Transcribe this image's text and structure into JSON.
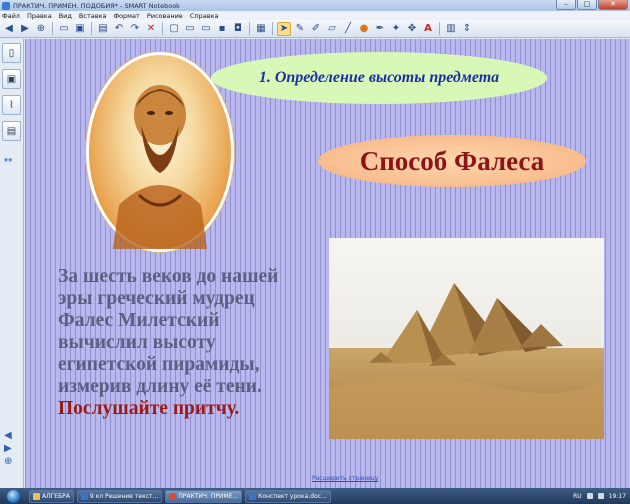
{
  "window": {
    "title": "ПРАКТИЧ. ПРИМЕН. ПОДОБИЯ* - SMART Notebook",
    "minimize": "–",
    "maximize": "□",
    "close": "✕"
  },
  "menu": [
    "Файл",
    "Правка",
    "Вид",
    "Вставка",
    "Формат",
    "Рисование",
    "Справка"
  ],
  "toolbar": {
    "icons": [
      "back-icon",
      "forward-icon",
      "add-page-icon",
      "open-icon",
      "save-icon",
      "paste-icon",
      "undo-icon",
      "redo-icon",
      "delete-icon",
      "screen-shade-icon",
      "full-screen-icon",
      "display-icon",
      "record-icon",
      "document-camera-icon",
      "table-icon",
      "select-icon",
      "pen-icon",
      "creative-pen-icon",
      "eraser-icon",
      "line-icon",
      "shape-icon",
      "fill-icon",
      "magic-pen-icon",
      "text-icon",
      "properties-icon",
      "toolbar-options-icon"
    ]
  },
  "slide": {
    "heading": "1. Определение высоты предмета",
    "method_title": "Способ Фалеса",
    "body_lines": [
      "За шесть веков до нашей",
      "эры греческий мудрец",
      "Фалес Милетский",
      "вычислил высоту",
      "египетской пирамиды,",
      "измерив длину её тени."
    ],
    "accent_line": "Послушайте притчу.",
    "page_link": "Расширить страницу"
  },
  "colors": {
    "canvas_bg": "#b8b7ee",
    "heading_oval": "#d8f8b8",
    "heading_text": "#1c2fa6",
    "method_oval": "#f9c193",
    "method_text": "#8a1418",
    "body_text": "#5b5f80",
    "accent_text": "#9b1a16"
  },
  "taskbar": {
    "items": [
      {
        "label": "АЛГЕБРА",
        "active": false
      },
      {
        "label": "9 кл Решение текст...",
        "active": false
      },
      {
        "label": "ПРАКТИЧ. ПРИМЕ...",
        "active": true
      },
      {
        "label": "Конспект урока.doc...",
        "active": false
      }
    ],
    "lang": "RU",
    "time": "19:17"
  }
}
